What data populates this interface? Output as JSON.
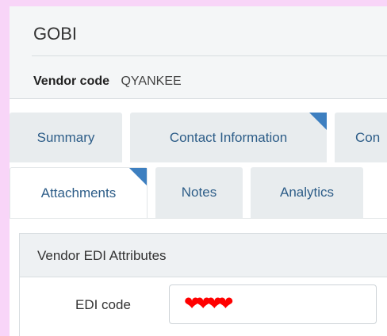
{
  "vendor": {
    "name": "GOBI",
    "code_label": "Vendor code",
    "code_value": "QYANKEE"
  },
  "tabs": {
    "row1": [
      "Summary",
      "Contact Information",
      "Con"
    ],
    "row2": [
      "Attachments",
      "Notes",
      "Analytics"
    ]
  },
  "section": {
    "title": "Vendor EDI Attributes",
    "edi_label": "EDI code",
    "edi_value_icon": "redacted-hearts"
  },
  "colors": {
    "accent": "#3d7fc0",
    "tab_text": "#2d5d88",
    "redaction": "#ff0000",
    "page_bg": "#f8d5f8"
  }
}
